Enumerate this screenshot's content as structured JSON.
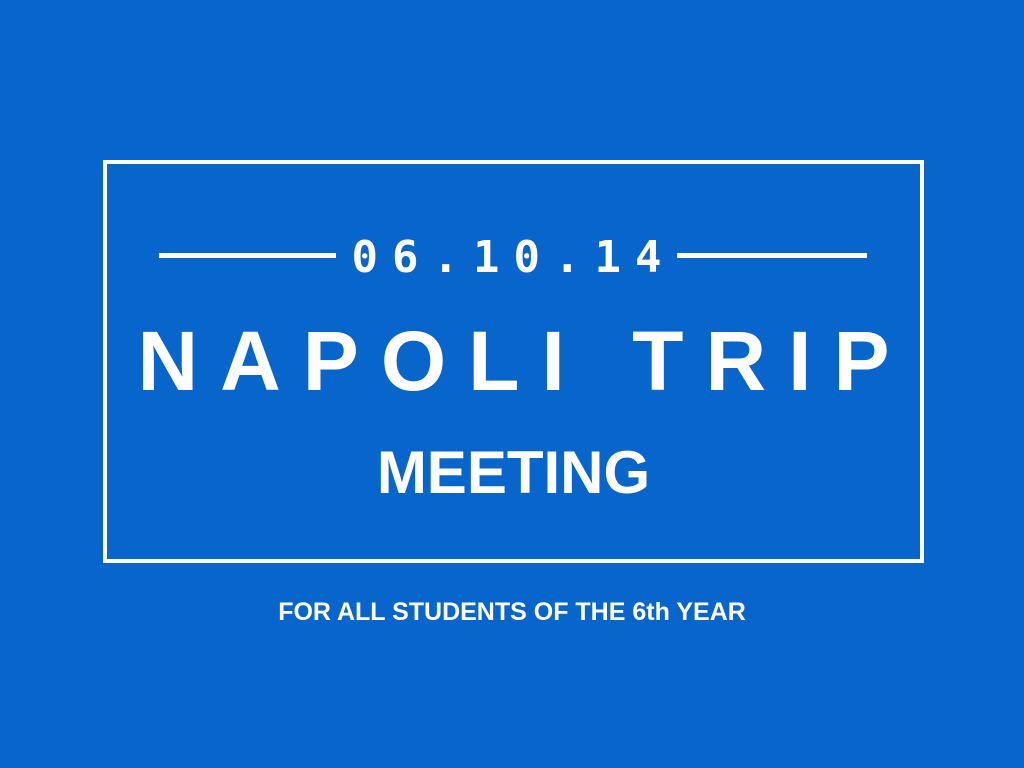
{
  "colors": {
    "background": "#0865cc",
    "foreground": "#ffffff"
  },
  "poster": {
    "date": "06.10.14",
    "title": "NAPOLI TRIP",
    "subtitle": "MEETING",
    "tagline": "FOR ALL STUDENTS OF THE 6th YEAR"
  }
}
